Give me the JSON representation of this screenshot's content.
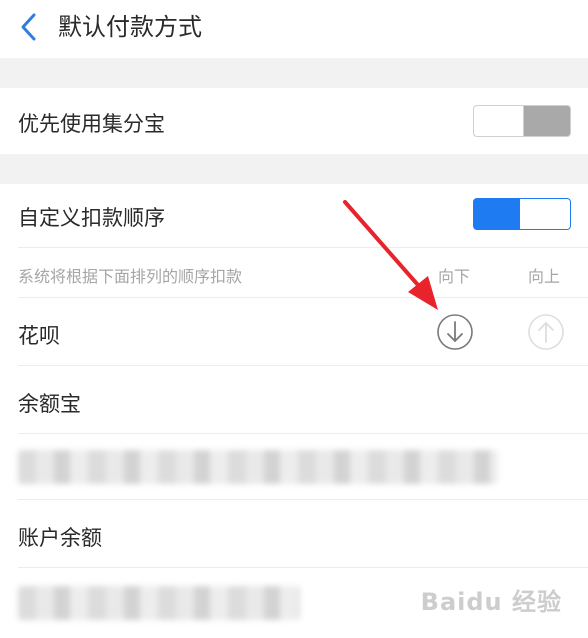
{
  "header": {
    "title": "默认付款方式",
    "back_icon": "chevron-left-icon"
  },
  "rows": {
    "prefer_jifenbao": {
      "label": "优先使用集分宝",
      "toggle_on": false
    },
    "custom_order": {
      "label": "自定义扣款顺序",
      "toggle_on": true
    }
  },
  "order_section": {
    "hint": "系统将根据下面排列的顺序扣款",
    "col_down": "向下",
    "col_up": "向上",
    "items": [
      {
        "label": "花呗"
      },
      {
        "label": "余额宝"
      },
      {
        "label": "账户余额"
      }
    ]
  },
  "colors": {
    "accent": "#1f7bf2",
    "annotation_arrow": "#e8232b"
  },
  "watermark": "Baidu 经验"
}
